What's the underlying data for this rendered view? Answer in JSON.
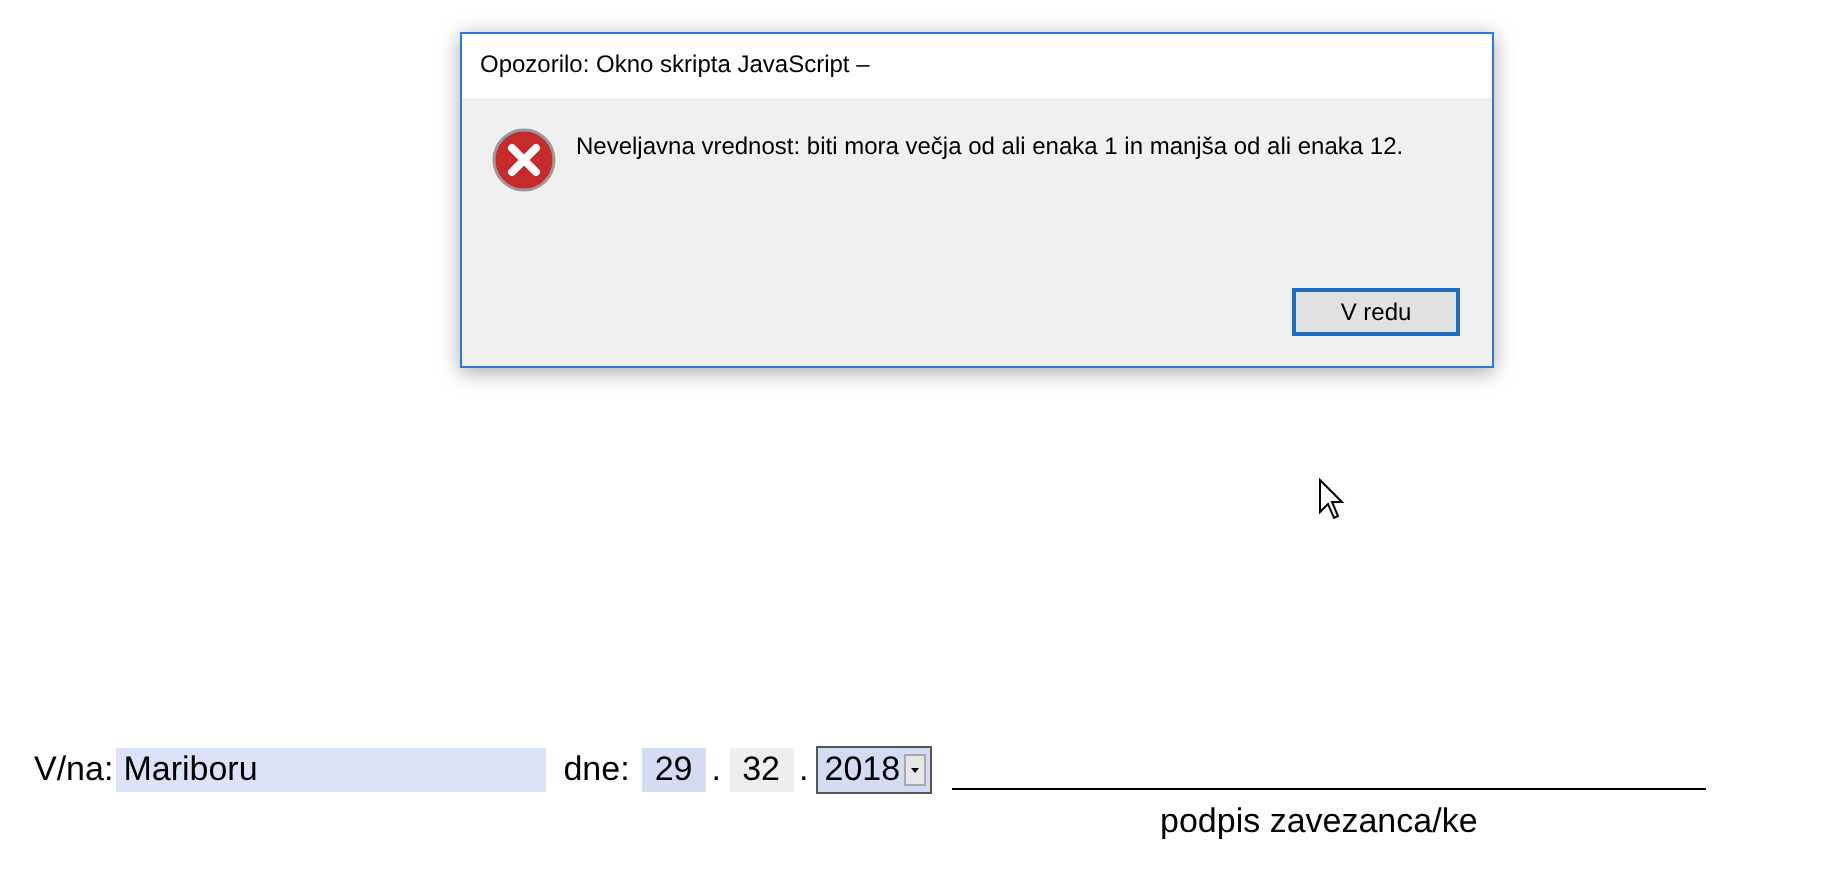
{
  "dialog": {
    "title": "Opozorilo: Okno skripta JavaScript –",
    "message": "Neveljavna vrednost: biti mora večja od ali enaka 1 in manjša od ali enaka 12.",
    "buttons": [
      {
        "label": "V redu",
        "selected": true
      }
    ]
  },
  "form": {
    "place_label": "V/na:",
    "place_value": "Mariboru",
    "date_label": "dne:",
    "date_fields": [
      {
        "value": "29",
        "kind": "text",
        "focused": false,
        "color": "#d4dcf4"
      },
      {
        "separator": ".",
        "value": "32",
        "kind": "text",
        "focused": false,
        "color": "#eeeeee"
      },
      {
        "separator": ".",
        "value": "2018",
        "kind": "dropdown",
        "focused": true,
        "color": "#d4dcf4"
      }
    ],
    "signature_caption": "podpis zavezanca/ke"
  }
}
